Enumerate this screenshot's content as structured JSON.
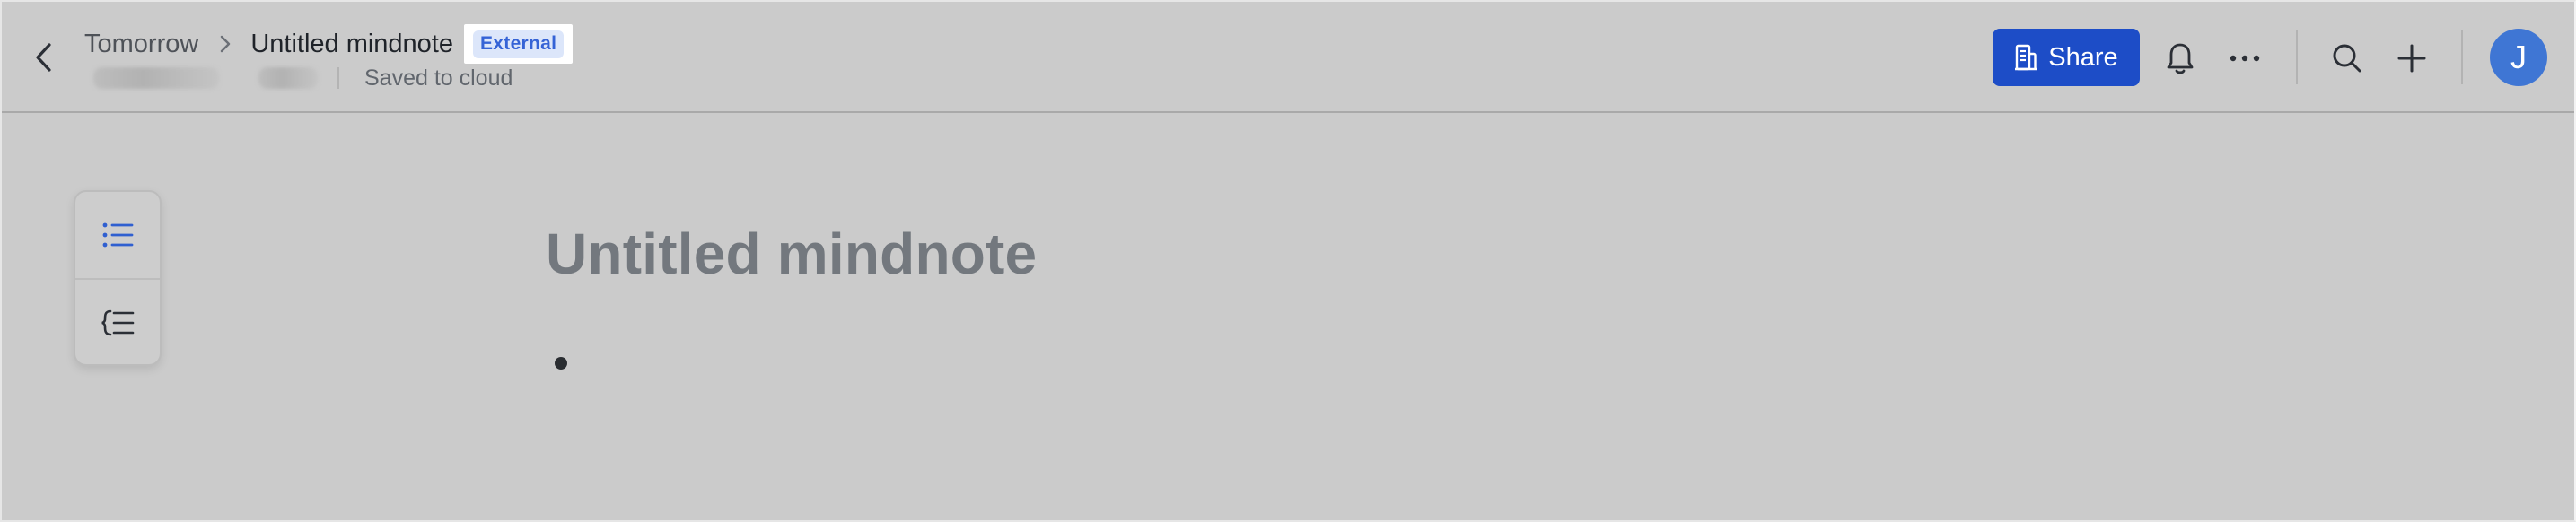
{
  "header": {
    "breadcrumb": {
      "parent": "Tomorrow",
      "current": "Untitled mindnote",
      "tag": "External"
    },
    "status": "Saved to cloud",
    "share_label": "Share",
    "avatar_initial": "J"
  },
  "toolbar": {
    "items": [
      "outline-view",
      "mindmap-view"
    ]
  },
  "document": {
    "title": "Untitled mindnote"
  },
  "colors": {
    "background": "#cbcbcb",
    "accent": "#1d4dc7",
    "tag_bg": "#dce6fa",
    "tag_text": "#3563d6",
    "avatar": "#3f76d4"
  }
}
